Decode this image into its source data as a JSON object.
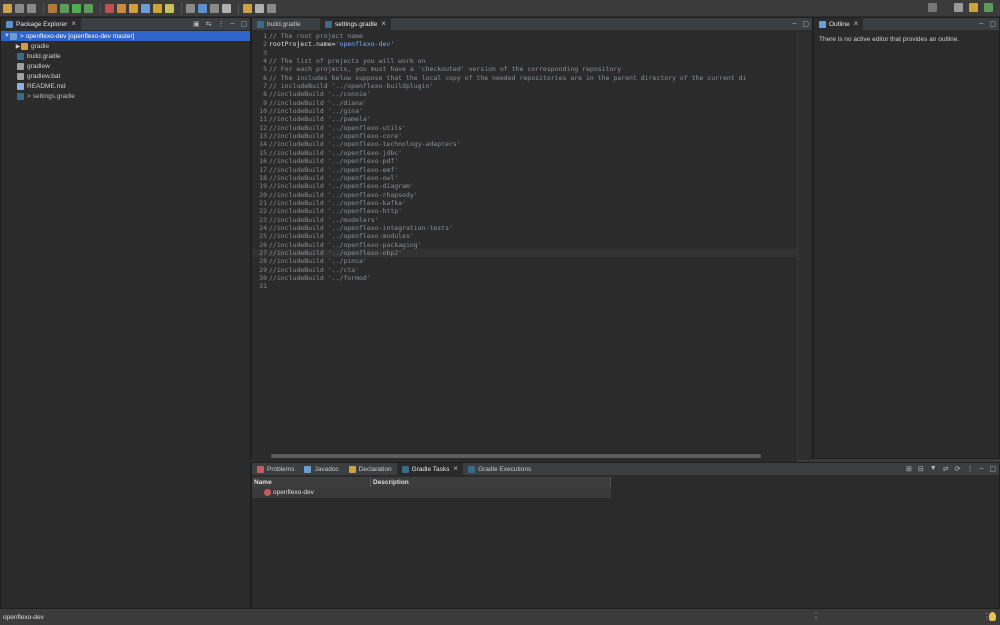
{
  "colors": {
    "selection": "#2f65ca",
    "string": "#79abff",
    "comment": "#8b9096",
    "background": "#2b2b2b"
  },
  "toolbar": {
    "icons": [
      "new-icon",
      "save-icon",
      "save-all-icon",
      "build-icon",
      "debug-icon",
      "run-icon",
      "coverage-icon",
      "external-tools-icon",
      "new-java-project-icon",
      "new-package-icon",
      "new-class-icon",
      "open-folder-icon",
      "pen-icon",
      "terminal-icon",
      "open-type-icon",
      "search-icon",
      "annotation-icon",
      "back-icon",
      "forward-icon",
      "pin-icon"
    ],
    "right_icons": [
      "search-icon",
      "open-perspective-icon",
      "java-perspective-icon",
      "debug-perspective-icon"
    ]
  },
  "explorer": {
    "tab_label": "Package Explorer",
    "tree": [
      {
        "label": "openflexo-dev [openflexo-dev master]",
        "prefix": "> ",
        "twisty": "▼",
        "icon": "project-icon",
        "indent": 0,
        "selected": true
      },
      {
        "label": "gradle",
        "prefix": "",
        "twisty": "▶",
        "icon": "folder-icon",
        "indent": 1,
        "selected": false
      },
      {
        "label": "build.gradle",
        "prefix": "",
        "twisty": "",
        "icon": "gradle-file-icon",
        "indent": 1,
        "selected": false
      },
      {
        "label": "gradlew",
        "prefix": "",
        "twisty": "",
        "icon": "file-icon",
        "indent": 1,
        "selected": false
      },
      {
        "label": "gradlew.bat",
        "prefix": "",
        "twisty": "",
        "icon": "file-icon",
        "indent": 1,
        "selected": false
      },
      {
        "label": "README.md",
        "prefix": "",
        "twisty": "",
        "icon": "markdown-file-icon",
        "indent": 1,
        "selected": false
      },
      {
        "label": "settings.gradle",
        "prefix": "> ",
        "twisty": "",
        "icon": "gradle-file-icon",
        "indent": 1,
        "selected": false,
        "dim": true
      }
    ]
  },
  "editor": {
    "tabs": [
      {
        "label": "build.gradle",
        "active": false,
        "closable": false
      },
      {
        "label": "settings.gradle",
        "active": true,
        "closable": true
      }
    ],
    "current_line": 27,
    "lines": [
      [
        {
          "t": "comment",
          "v": "// The root project name"
        }
      ],
      [
        {
          "t": "plain",
          "v": "rootProject.name="
        },
        {
          "t": "string",
          "v": "'openflexo-dev'"
        }
      ],
      [],
      [
        {
          "t": "comment",
          "v": "// The list of projects you will work on"
        }
      ],
      [
        {
          "t": "comment",
          "v": "// For each projects, you must have a 'checkouted' version of the corresponding repository"
        }
      ],
      [
        {
          "t": "comment",
          "v": "// The includes below suppose that the local copy of the needed repositories are in the parent directory of the current di"
        }
      ],
      [
        {
          "t": "comment",
          "v": "// includeBuild '../openflexo-buildplugin'"
        }
      ],
      [
        {
          "t": "comment",
          "v": "//includeBuild '../connie'"
        }
      ],
      [
        {
          "t": "comment",
          "v": "//includeBuild '../diana'"
        }
      ],
      [
        {
          "t": "comment",
          "v": "//includeBuild '../gina'"
        }
      ],
      [
        {
          "t": "comment",
          "v": "//includeBuild '../pamela'"
        }
      ],
      [
        {
          "t": "comment",
          "v": "//includeBuild '../openflexo-utils'"
        }
      ],
      [
        {
          "t": "comment",
          "v": "//includeBuild '../openflexo-core'"
        }
      ],
      [
        {
          "t": "comment",
          "v": "//includeBuild '../openflexo-technology-adapters'"
        }
      ],
      [
        {
          "t": "comment",
          "v": "//includeBuild '../openflexo-jdbc'"
        }
      ],
      [
        {
          "t": "comment",
          "v": "//includeBuild '../openflexo-pdf'"
        }
      ],
      [
        {
          "t": "comment",
          "v": "//includeBuild '../openflexo-emf'"
        }
      ],
      [
        {
          "t": "comment",
          "v": "//includeBuild '../openflexo-owl'"
        }
      ],
      [
        {
          "t": "comment",
          "v": "//includeBuild '../openflexo-diagram'"
        }
      ],
      [
        {
          "t": "comment",
          "v": "//includeBuild '../openflexo-rhapsody'"
        }
      ],
      [
        {
          "t": "comment",
          "v": "//includeBuild '../openflexo-kafka'"
        }
      ],
      [
        {
          "t": "comment",
          "v": "//includeBuild '../openflexo-http'"
        }
      ],
      [
        {
          "t": "comment",
          "v": "//includeBuild '../modelers'"
        }
      ],
      [
        {
          "t": "comment",
          "v": "//includeBuild '../openflexo-integration-tests'"
        }
      ],
      [
        {
          "t": "comment",
          "v": "//includeBuild '../openflexo-modules'"
        }
      ],
      [
        {
          "t": "comment",
          "v": "//includeBuild '../openflexo-packaging'"
        }
      ],
      [
        {
          "t": "comment",
          "v": "//includeBuild '../openflexo-obp2'"
        }
      ],
      [
        {
          "t": "comment",
          "v": "//includeBuild '../pinca'"
        }
      ],
      [
        {
          "t": "comment",
          "v": "//includeBuild '../cta'"
        }
      ],
      [
        {
          "t": "comment",
          "v": "//includeBuild '../formod'"
        }
      ],
      []
    ]
  },
  "outline": {
    "tab_label": "Outline",
    "message": "There is no active editor that provides an outline."
  },
  "bottom": {
    "tabs": [
      {
        "label": "Problems",
        "icon": "problems-icon",
        "active": false,
        "closable": false
      },
      {
        "label": "Javadoc",
        "icon": "javadoc-icon",
        "active": false,
        "closable": false
      },
      {
        "label": "Declaration",
        "icon": "declaration-icon",
        "active": false,
        "closable": false
      },
      {
        "label": "Gradle Tasks",
        "icon": "gradle-icon",
        "active": true,
        "closable": true
      },
      {
        "label": "Gradle Executions",
        "icon": "gradle-icon",
        "active": false,
        "closable": false
      }
    ],
    "columns": [
      "Name",
      "Description"
    ],
    "rows": [
      {
        "name": "openflexo-dev",
        "description": ""
      }
    ]
  },
  "status": {
    "text": "openflexo-dev"
  }
}
